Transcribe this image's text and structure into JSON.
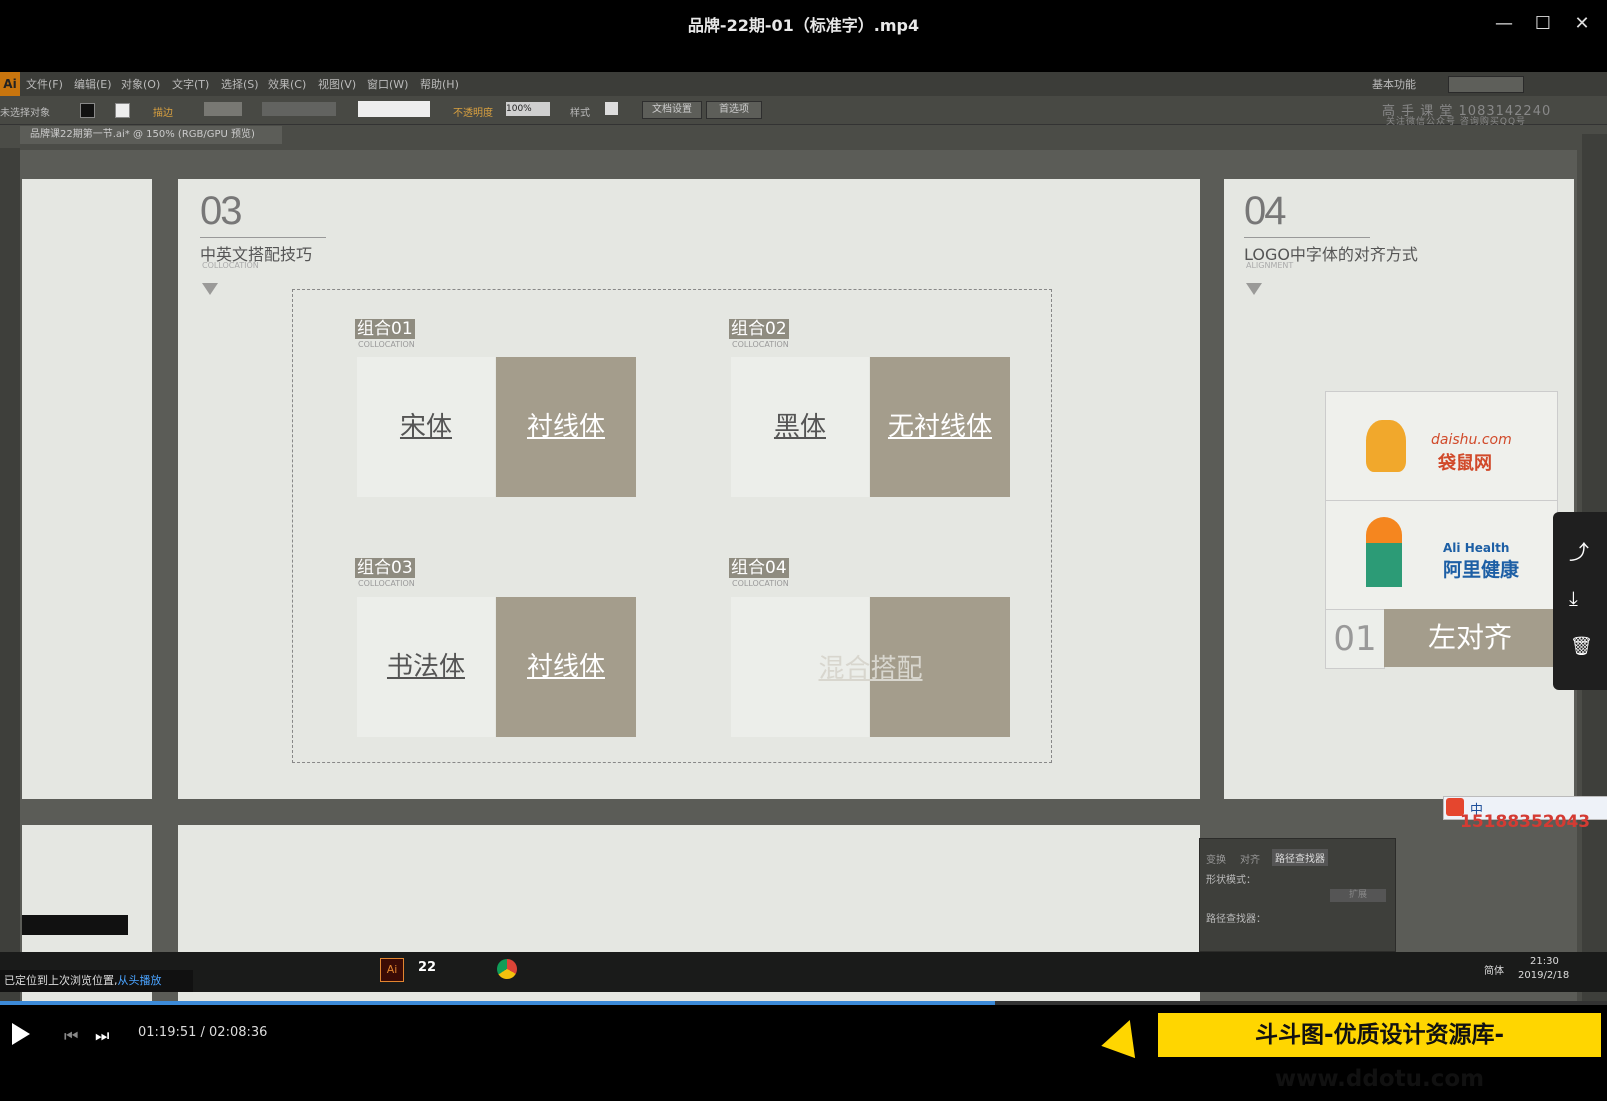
{
  "player": {
    "title": "品牌-22期-01（标准字）.mp4",
    "minimize": "—",
    "maximize": "☐",
    "close": "✕",
    "time": "01:19:51 / 02:08:36",
    "progress": 0.619,
    "brand": "斗斗图-优质设计资源库-www.ddotu.com",
    "toast_text": "已定位到上次浏览位置,",
    "toast_link": "从头播放"
  },
  "app": {
    "logo": "Ai",
    "menus": [
      "文件(F)",
      "编辑(E)",
      "对象(O)",
      "文字(T)",
      "选择(S)",
      "效果(C)",
      "视图(V)",
      "窗口(W)",
      "帮助(H)"
    ],
    "workspace": "基本功能",
    "ctrl": {
      "no_selection": "未选择对象",
      "stroke": "描边",
      "opacity": "不透明度",
      "opacity_value": "100%",
      "style": "样式",
      "doc_setup": "文档设置",
      "prefs": "首选项"
    },
    "doc_tab": "品牌课22期第一节.ai* @ 150% (RGB/GPU 预览)",
    "watermark_line1": "高 手 课 堂   1083142240",
    "watermark_line2": "关注微信公众号  咨询购买QQ号"
  },
  "board3": {
    "number": "03",
    "title": "中英文搭配技巧",
    "subtitle": "COLLOCATION",
    "combos": [
      {
        "tag": "组合01",
        "sub": "COLLOCATION",
        "left": "宋体",
        "right": "衬线体"
      },
      {
        "tag": "组合02",
        "sub": "COLLOCATION",
        "left": "黑体",
        "right": "无衬线体"
      },
      {
        "tag": "组合03",
        "sub": "COLLOCATION",
        "left": "书法体",
        "right": "衬线体"
      },
      {
        "tag": "组合04",
        "sub": "COLLOCATION",
        "left": "",
        "right": "",
        "center": "混合搭配"
      }
    ]
  },
  "board4": {
    "number": "04",
    "title": "LOGO中字体的对齐方式",
    "subtitle": "ALIGNMENT",
    "logo1_en": "daishu.com",
    "logo1_cn": "袋鼠网",
    "logo2_en": "Ali Health",
    "logo2_cn": "阿里健康",
    "align_num": "01",
    "align_label": "左对齐"
  },
  "pathfinder": {
    "tabs": [
      "变换",
      "对齐",
      "路径查找器"
    ],
    "shape_modes": "形状模式：",
    "pathfinders": "路径查找器：",
    "expand": "扩展"
  },
  "ime": {
    "lang": "中",
    "phone": "15188352043"
  },
  "vtaskbar": {
    "time": "21:30",
    "date": "2019/2/18",
    "lang": "简体",
    "app_num": "22"
  }
}
